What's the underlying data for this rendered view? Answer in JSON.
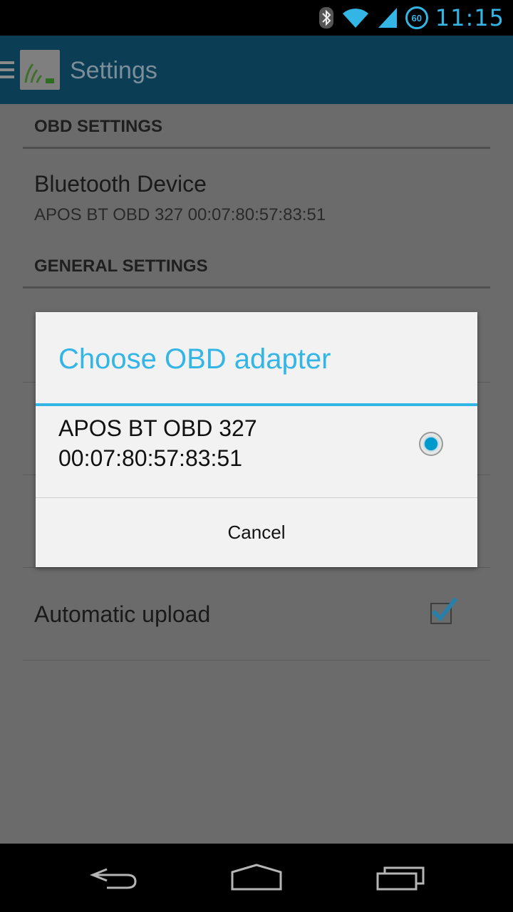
{
  "status_bar": {
    "time": "11:15",
    "battery_badge": "60",
    "icons": [
      "bluetooth-icon",
      "wifi-icon",
      "cell-signal-icon",
      "battery-icon"
    ]
  },
  "action_bar": {
    "title": "Settings",
    "icons": [
      "menu-icon",
      "app-logo-icon"
    ]
  },
  "settings": {
    "obd_header": "OBD SETTINGS",
    "bluetooth_title": "Bluetooth Device",
    "bluetooth_value": "APOS BT OBD 327 00:07:80:57:83:51",
    "general_header": "GENERAL SETTINGS",
    "auto_upload_title": "Automatic upload",
    "auto_upload_checked": true
  },
  "dialog": {
    "title": "Choose OBD adapter",
    "options": [
      {
        "label": "APOS BT OBD 327 00:07:80:57:83:51",
        "selected": true
      }
    ],
    "cancel_label": "Cancel"
  },
  "nav_bar": {
    "icons": [
      "back-icon",
      "home-icon",
      "recents-icon"
    ]
  },
  "colors": {
    "accent": "#33b5e5",
    "action_bar": "#0b3d55",
    "scrim_bg": "#6b6b6b"
  }
}
